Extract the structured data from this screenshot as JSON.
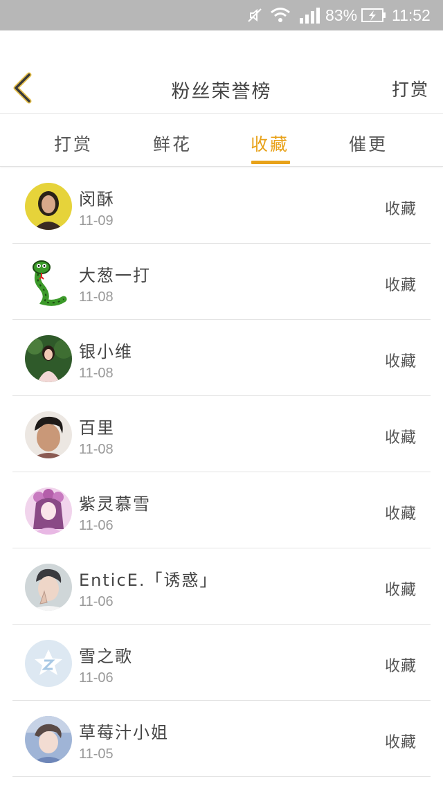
{
  "status_bar": {
    "battery_percent": "83%",
    "time": "11:52",
    "icons": [
      "mute-icon",
      "wifi-icon",
      "signal-icon",
      "battery-charging-icon"
    ]
  },
  "header": {
    "title": "粉丝荣誉榜",
    "right_action": "打赏",
    "back_icon": "chevron-left-icon"
  },
  "tabs": [
    {
      "label": "打赏",
      "active": false
    },
    {
      "label": "鲜花",
      "active": false
    },
    {
      "label": "收藏",
      "active": true
    },
    {
      "label": "催更",
      "active": false
    }
  ],
  "colors": {
    "accent": "#e8a21a",
    "status_bar": "#b7b7b7",
    "divider": "#e3e3e3"
  },
  "fans": [
    {
      "name": "闵酥",
      "date": "11-09",
      "action": "收藏",
      "avatar": "avatar-woman-yellow"
    },
    {
      "name": "大葱一打",
      "date": "11-08",
      "action": "收藏",
      "avatar": "avatar-snake-cartoon"
    },
    {
      "name": "银小维",
      "date": "11-08",
      "action": "收藏",
      "avatar": "avatar-girl-green"
    },
    {
      "name": "百里",
      "date": "11-08",
      "action": "收藏",
      "avatar": "avatar-boy"
    },
    {
      "name": "紫灵慕雪",
      "date": "11-06",
      "action": "收藏",
      "avatar": "avatar-anime-pink"
    },
    {
      "name": "EnticE.「诱惑」",
      "date": "11-06",
      "action": "收藏",
      "avatar": "avatar-man-selfie"
    },
    {
      "name": "雪之歌",
      "date": "11-06",
      "action": "收藏",
      "avatar": "avatar-default-star"
    },
    {
      "name": "草莓汁小姐",
      "date": "11-05",
      "action": "收藏",
      "avatar": "avatar-girl-blue"
    }
  ]
}
